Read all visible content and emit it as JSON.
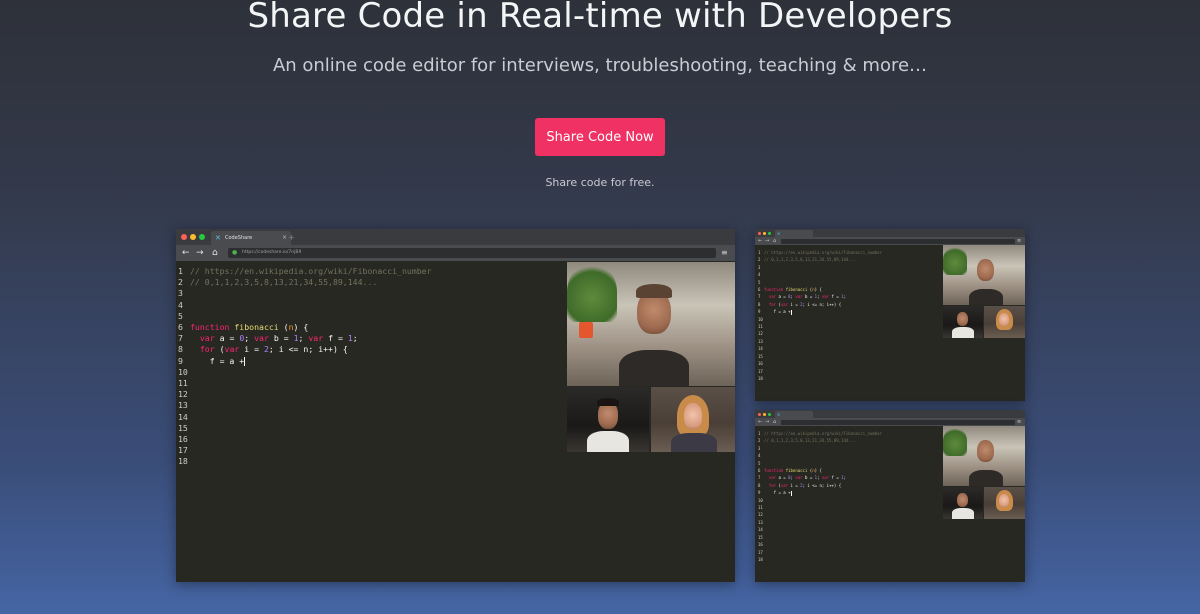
{
  "hero": {
    "title": "Share Code in Real-time with Developers",
    "subtitle": "An online code editor for interviews, troubleshooting, teaching & more…",
    "cta_label": "Share Code Now",
    "free_note": "Share code for free."
  },
  "colors": {
    "cta": "#ef3263",
    "editor_bg": "#272822",
    "comment": "#75715e",
    "keyword": "#f92672",
    "function_name": "#e6db74",
    "number": "#ae81ff"
  },
  "browser": {
    "tab_title": "CodeShare",
    "url": "https://codeshare.io/7njB9",
    "icons": [
      "close-window-dot",
      "minimize-window-dot",
      "maximize-window-dot",
      "back-arrow-icon",
      "forward-arrow-icon",
      "home-icon",
      "lock-icon",
      "menu-icon",
      "codeshare-logo-icon",
      "new-tab-icon"
    ]
  },
  "code": {
    "lines": [
      "// https://en.wikipedia.org/wiki/Fibonacci_number",
      "// 0,1,1,2,3,5,8,13,21,34,55,89,144...",
      "",
      "",
      "",
      "function fibonacci (n) {",
      "  var a = 0; var b = 1; var f = 1;",
      "  for (var i = 2; i <= n; i++) {",
      "    f = a +",
      "",
      "",
      "",
      "",
      "",
      "",
      "",
      "",
      ""
    ],
    "line_count": 18
  }
}
